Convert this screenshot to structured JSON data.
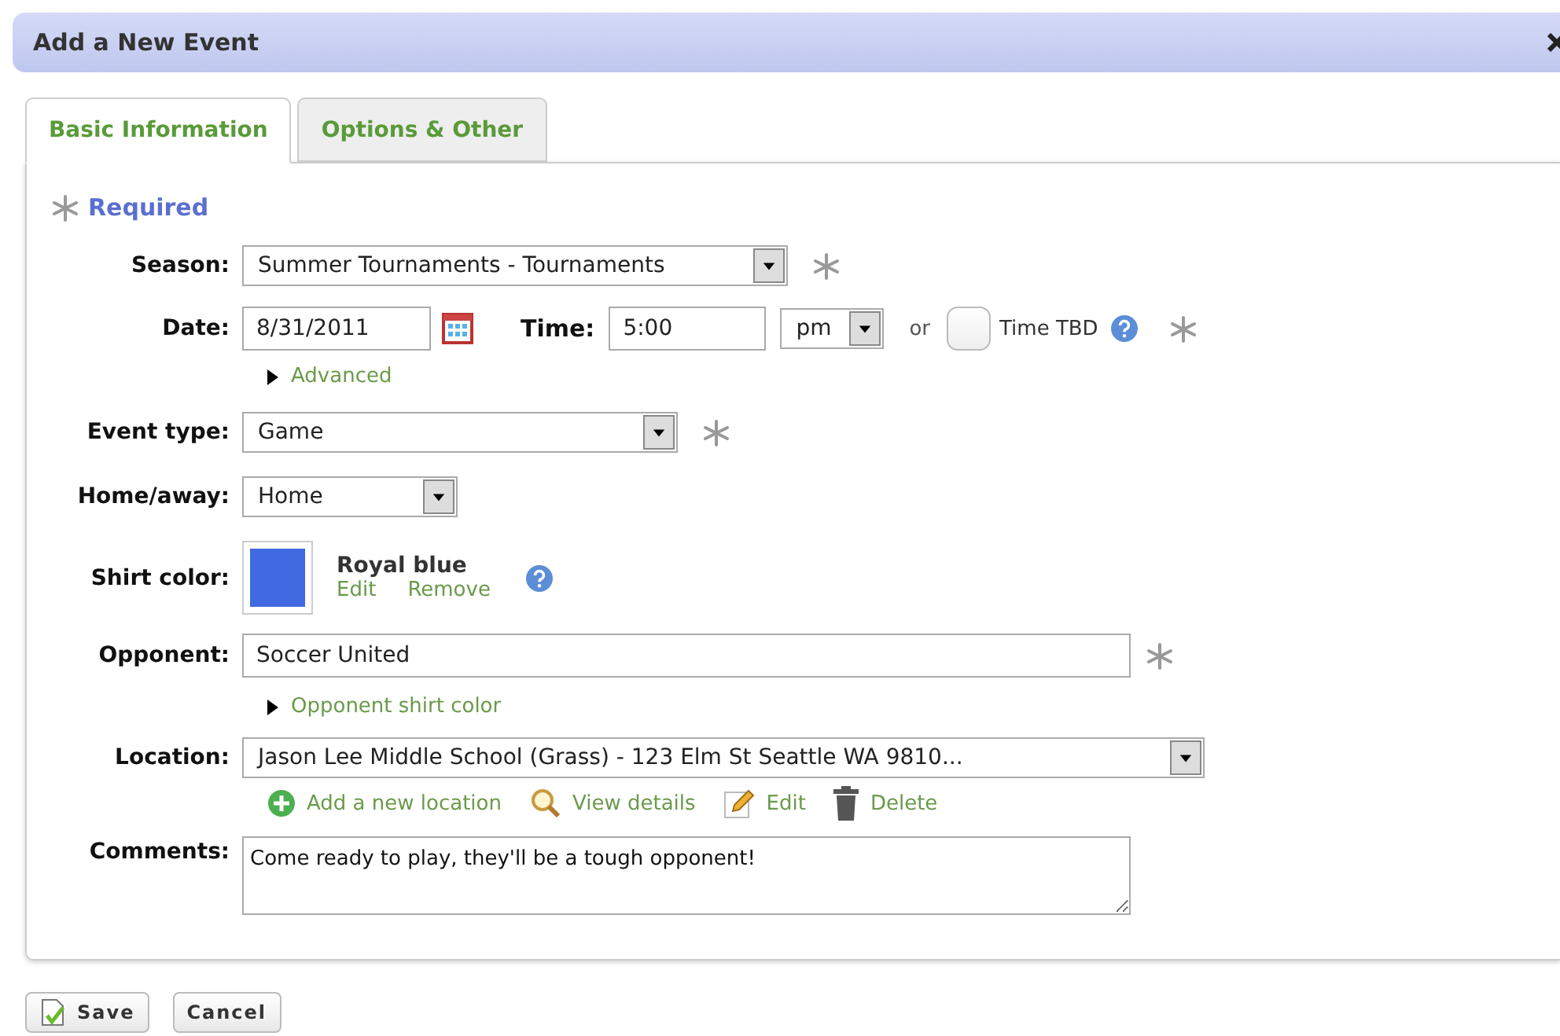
{
  "dialog": {
    "title": "Add a New Event"
  },
  "tabs": [
    {
      "label": "Basic Information",
      "selected": true
    },
    {
      "label": "Options & Other",
      "selected": false
    }
  ],
  "required_note": "Required",
  "season": {
    "label": "Season:",
    "value": "Summer Tournaments - Tournaments",
    "required": true
  },
  "date": {
    "label": "Date:",
    "value": "8/31/2011"
  },
  "time": {
    "label": "Time:",
    "value": "5:00",
    "ampm": "pm",
    "or": "or",
    "tbd_label": "Time TBD",
    "tbd_checked": false,
    "required": true
  },
  "advanced": {
    "label": "Advanced",
    "expanded": false
  },
  "event_type": {
    "label": "Event type:",
    "value": "Game",
    "required": true
  },
  "home_away": {
    "label": "Home/away:",
    "value": "Home"
  },
  "shirt_color": {
    "label": "Shirt color:",
    "color": "#4169e1",
    "name": "Royal blue",
    "edit": "Edit",
    "remove": "Remove"
  },
  "opponent": {
    "label": "Opponent:",
    "value": "Soccer United",
    "required": true
  },
  "opponent_shirt": {
    "label": "Opponent shirt color",
    "expanded": false
  },
  "location": {
    "label": "Location:",
    "value": "Jason Lee Middle School (Grass) - 123 Elm St Seattle WA 9810...",
    "actions": [
      {
        "kind": "add",
        "label": "Add a new location"
      },
      {
        "kind": "view",
        "label": "View details"
      },
      {
        "kind": "edit",
        "label": "Edit"
      },
      {
        "kind": "delete",
        "label": "Delete"
      }
    ]
  },
  "comments": {
    "label": "Comments:",
    "value": "Come ready to play, they'll be a tough opponent!"
  },
  "buttons": [
    {
      "kind": "save",
      "label": "Save"
    },
    {
      "kind": "cancel",
      "label": "Cancel"
    }
  ]
}
